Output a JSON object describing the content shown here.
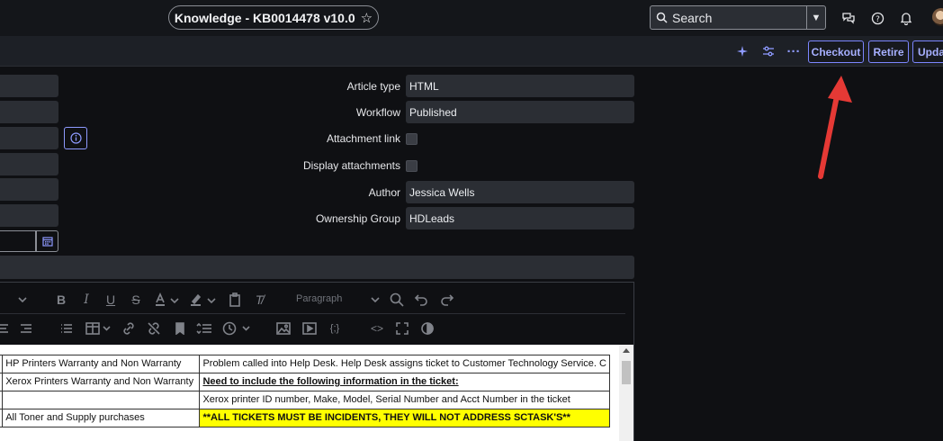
{
  "header": {
    "title": "Knowledge - KB0014478 v10.0",
    "star_icon": "star-icon",
    "search_label": "Search"
  },
  "actions": {
    "checkout": "Checkout",
    "retire": "Retire",
    "update": "Upda"
  },
  "form": {
    "fields": [
      {
        "label": "Article type",
        "value": "HTML"
      },
      {
        "label": "Workflow",
        "value": "Published"
      },
      {
        "label": "Attachment link",
        "checked": false
      },
      {
        "label": "Display attachments",
        "checked": false
      },
      {
        "label": "Author",
        "value": "Jessica Wells"
      },
      {
        "label": "Ownership Group",
        "value": "HDLeads"
      }
    ]
  },
  "editor": {
    "paragraph": "Paragraph"
  },
  "doc": {
    "rows": [
      {
        "c1": "HP Printers Warranty and Non Warranty",
        "c2": "Problem called into Help Desk.  Help Desk assigns ticket to Customer Technology Service.  C"
      },
      {
        "c1": "Xerox Printers Warranty and Non Warranty",
        "c2": "Need to include the following information in the ticket:"
      },
      {
        "c1": "",
        "c2": "Xerox printer ID number, Make, Model, Serial Number and Acct Number in the ticket"
      },
      {
        "c1": "All Toner and Supply purchases",
        "c2": "**ALL TICKETS MUST BE INCIDENTS, THEY WILL NOT ADDRESS SCTASK'S**"
      }
    ]
  },
  "colors": {
    "accent": "#7c86ff",
    "annotation": "#e53935",
    "highlight": "#ffff00"
  }
}
